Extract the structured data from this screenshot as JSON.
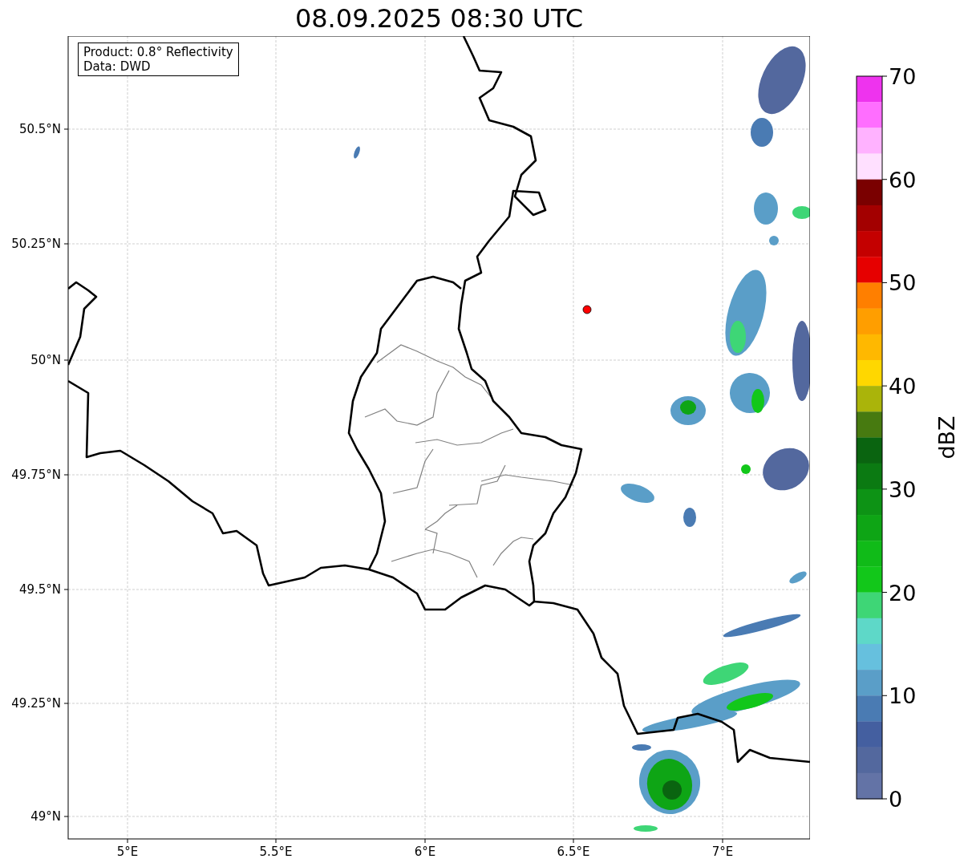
{
  "title": "08.09.2025 08:30 UTC",
  "info_box": [
    "Product: 0.8° Reflectivity",
    "Data: DWD"
  ],
  "x_ticks": [
    "5°E",
    "5.5°E",
    "6°E",
    "6.5°E",
    "7°E"
  ],
  "y_ticks": [
    "50.5°N",
    "50.25°N",
    "50°N",
    "49.75°N",
    "49.5°N",
    "49.25°N",
    "49°N"
  ],
  "colorbar": {
    "label": "dBZ",
    "ticks": [
      "70",
      "60",
      "50",
      "40",
      "30",
      "20",
      "10",
      "0"
    ],
    "segments": [
      {
        "color": "#ee33ee"
      },
      {
        "color": "#ff6eff"
      },
      {
        "color": "#ffb2ff"
      },
      {
        "color": "#ffe0ff"
      },
      {
        "color": "#7a0000"
      },
      {
        "color": "#a30000"
      },
      {
        "color": "#c40000"
      },
      {
        "color": "#e60000"
      },
      {
        "color": "#ff7f00"
      },
      {
        "color": "#ff9e00"
      },
      {
        "color": "#ffb800"
      },
      {
        "color": "#ffd700"
      },
      {
        "color": "#aab40a"
      },
      {
        "color": "#477a10"
      },
      {
        "color": "#0a6410"
      },
      {
        "color": "#0b7a12"
      },
      {
        "color": "#0d9315"
      },
      {
        "color": "#0ea515"
      },
      {
        "color": "#10bb18"
      },
      {
        "color": "#12c71a"
      },
      {
        "color": "#3ed676"
      },
      {
        "color": "#5ed8c8"
      },
      {
        "color": "#66c0de"
      },
      {
        "color": "#5a9ec8"
      },
      {
        "color": "#4a7bb3"
      },
      {
        "color": "#445fa0"
      },
      {
        "color": "#53689e"
      },
      {
        "color": "#6373a6"
      }
    ]
  }
}
